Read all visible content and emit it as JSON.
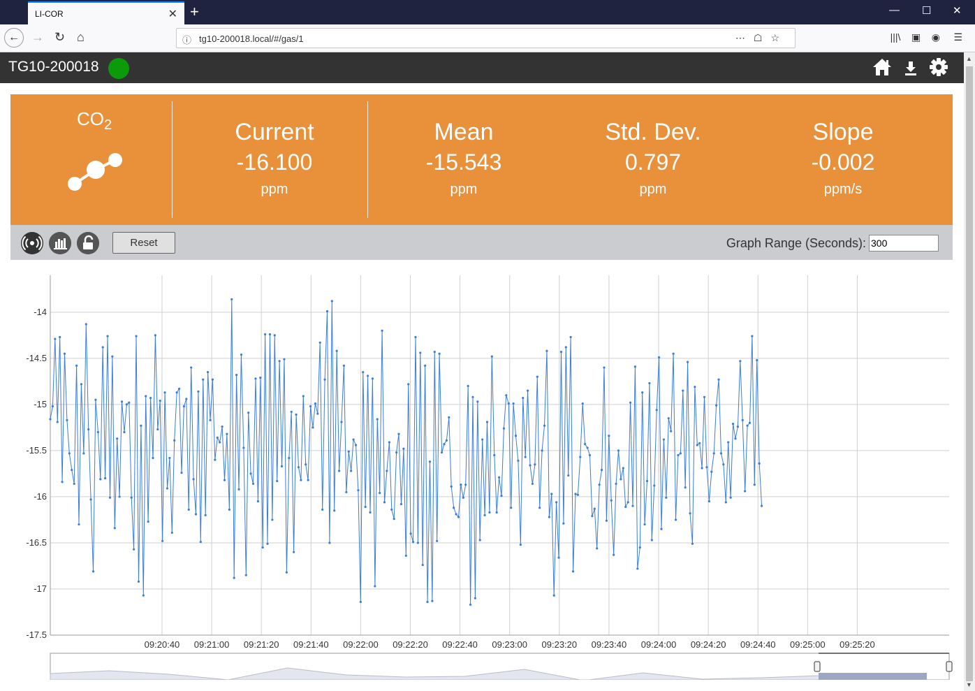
{
  "browser": {
    "tab_title": "LI-COR",
    "url": "tg10-200018.local/#/gas/1",
    "new_tab": "+",
    "close": "✕"
  },
  "header": {
    "device_name": "TG10-200018",
    "status_color": "#0a9a0a",
    "icons": [
      "home-icon",
      "download-icon",
      "gear-icon"
    ]
  },
  "gas": {
    "name_main": "CO",
    "name_sub": "2",
    "icon": "molecule-icon"
  },
  "stats": [
    {
      "label": "Current",
      "value": "-16.100",
      "unit": "ppm"
    },
    {
      "label": "Mean",
      "value": "-15.543",
      "unit": "ppm"
    },
    {
      "label": "Std. Dev.",
      "value": "0.797",
      "unit": "ppm"
    },
    {
      "label": "Slope",
      "value": "-0.002",
      "unit": "ppm/s"
    }
  ],
  "toolbar": {
    "reset_label": "Reset",
    "range_label": "Graph Range (Seconds):",
    "range_value": "300",
    "icons": [
      "broadcast-icon",
      "bar-chart-icon",
      "unlock-icon"
    ]
  },
  "colors": {
    "accent": "#e8913a",
    "line": "#3b7dd8",
    "header": "#333333"
  },
  "chart_data": {
    "type": "line",
    "ylim": [
      -17.5,
      -13.6
    ],
    "yticks": [
      "-14",
      "-14.5",
      "-15",
      "-15.5",
      "-16",
      "-16.5",
      "-17",
      "-17.5"
    ],
    "ytick_values": [
      -14,
      -14.5,
      -15,
      -15.5,
      -16,
      -16.5,
      -17,
      -17.5
    ],
    "xlim_seconds": [
      -45,
      317
    ],
    "xticks": [
      "09:20:40",
      "09:21:00",
      "09:21:20",
      "09:21:40",
      "09:22:00",
      "09:22:20",
      "09:22:40",
      "09:23:00",
      "09:23:20",
      "09:23:40",
      "09:24:00",
      "09:24:20",
      "09:24:40",
      "09:25:00",
      "09:25:20"
    ],
    "xtick_seconds": [
      0,
      20,
      40,
      60,
      80,
      100,
      120,
      140,
      160,
      180,
      200,
      220,
      240,
      260,
      280
    ],
    "grid": true,
    "series": [
      {
        "values": [
          -15.16,
          -15.02,
          -14.29,
          -15.19,
          -14.27,
          -15.84,
          -14.45,
          -15.17,
          -15.53,
          -15.71,
          -15.86,
          -14.58,
          -16.3,
          -14.78,
          -15.53,
          -14.13,
          -15.27,
          -16.03,
          -16.81,
          -14.95,
          -15.3,
          -15.81,
          -14.38,
          -15.8,
          -14.26,
          -16.01,
          -14.48,
          -16.34,
          -15.37,
          -16.0,
          -14.97,
          -15.3,
          -15.0,
          -14.98,
          -16.01,
          -16.57,
          -14.26,
          -16.92,
          -15.23,
          -17.07,
          -14.91,
          -16.27,
          -14.93,
          -15.58,
          -14.25,
          -15.27,
          -14.96,
          -16.48,
          -14.87,
          -15.91,
          -15.58,
          -16.39,
          -15.39,
          -14.87,
          -14.83,
          -15.74,
          -15.02,
          -14.94,
          -16.14,
          -14.6,
          -15.81,
          -16.19,
          -14.86,
          -16.49,
          -14.73,
          -16.2,
          -14.65,
          -15.17,
          -14.73,
          -15.6,
          -15.36,
          -15.41,
          -15.24,
          -15.82,
          -15.32,
          -16.14,
          -13.86,
          -16.88,
          -14.68,
          -15.92,
          -14.46,
          -15.47,
          -16.85,
          -15.09,
          -15.75,
          -15.86,
          -14.72,
          -16.05,
          -14.71,
          -16.55,
          -14.24,
          -16.51,
          -14.24,
          -16.25,
          -14.25,
          -15.83,
          -14.53,
          -15.67,
          -14.51,
          -16.82,
          -15.58,
          -15.08,
          -16.6,
          -15.11,
          -15.68,
          -15.82,
          -14.91,
          -15.65,
          -15.82,
          -15.02,
          -15.25,
          -14.99,
          -15.1,
          -14.33,
          -16.14,
          -14.73,
          -13.99,
          -16.5,
          -13.88,
          -16.15,
          -14.42,
          -15.72,
          -15.19,
          -14.58,
          -15.95,
          -15.51,
          -15.72,
          -15.38,
          -15.44,
          -15.93,
          -17.14,
          -14.65,
          -16.11,
          -14.69,
          -16.17,
          -14.72,
          -16.97,
          -15.16,
          -15.96,
          -14.2,
          -16.06,
          -15.72,
          -15.41,
          -16.14,
          -16.24,
          -15.52,
          -15.32,
          -16.08,
          -15.48,
          -16.64,
          -14.78,
          -16.4,
          -16.49,
          -14.27,
          -16.5,
          -14.44,
          -16.74,
          -14.58,
          -17.14,
          -15.62,
          -17.13,
          -14.43,
          -16.48,
          -14.45,
          -15.52,
          -15.43,
          -15.39,
          -15.14,
          -15.89,
          -16.12,
          -16.19,
          -16.22,
          -15.87,
          -16.01,
          -15.87,
          -14.8,
          -17.17,
          -14.92,
          -17.1,
          -14.97,
          -16.47,
          -15.38,
          -16.2,
          -15.19,
          -16.17,
          -14.48,
          -15.55,
          -16.17,
          -15.79,
          -15.99,
          -15.26,
          -14.9,
          -14.99,
          -16.12,
          -14.99,
          -15.34,
          -15.61,
          -16.52,
          -14.93,
          -15.57,
          -14.85,
          -15.66,
          -15.86,
          -15.65,
          -14.7,
          -16.12,
          -15.5,
          -15.23,
          -14.42,
          -16.22,
          -15.97,
          -17.07,
          -16.06,
          -16.66,
          -14.43,
          -16.29,
          -14.38,
          -15.77,
          -14.27,
          -16.81,
          -15.97,
          -15.98,
          -15.57,
          -14.99,
          -15.43,
          -15.47,
          -15.55,
          -16.21,
          -16.13,
          -16.56,
          -15.87,
          -15.71,
          -14.6,
          -16.26,
          -15.34,
          -16.04,
          -16.63,
          -15.86,
          -15.5,
          -15.81,
          -15.69,
          -16.11,
          -16.06,
          -14.98,
          -16.1,
          -14.59,
          -16.78,
          -16.55,
          -14.87,
          -16.3,
          -15.83,
          -14.77,
          -16.47,
          -15.88,
          -15.06,
          -14.49,
          -16.35,
          -15.38,
          -16.01,
          -15.15,
          -15.29,
          -14.45,
          -16.25,
          -15.55,
          -15.53,
          -14.85,
          -15.9,
          -14.54,
          -16.18,
          -16.51,
          -14.81,
          -15.44,
          -15.42,
          -15.69,
          -14.92,
          -15.68,
          -16.05,
          -15.73,
          -15.53,
          -15.01,
          -14.73,
          -15.53,
          -15.65,
          -16.06,
          -15.41,
          -16.01,
          -15.21,
          -15.37,
          -15.24,
          -14.53,
          -15.17,
          -15.94,
          -15.23,
          -15.2,
          -14.26,
          -15.87,
          -14.52,
          -15.64,
          -16.1
        ]
      },
      {
        "values": [
          -15.1,
          -14.7,
          -15.2,
          -16.0,
          -14.3,
          -15.3,
          -15.6,
          -15.5,
          -14.5,
          -16.1,
          -15.0,
          -15.9,
          -15.7,
          -15.4
        ]
      }
    ]
  }
}
